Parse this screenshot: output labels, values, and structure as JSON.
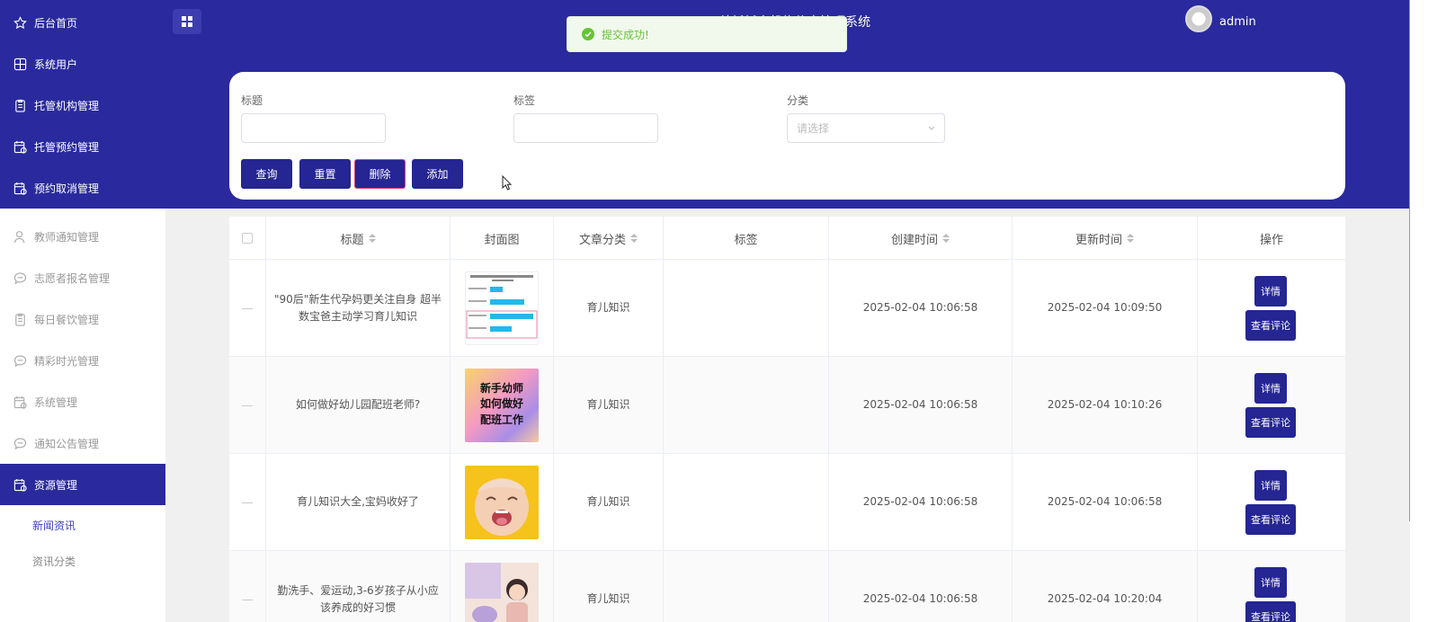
{
  "app": {
    "title": "幼托托育机构信息管理系统",
    "user": "admin"
  },
  "toast": {
    "message": "提交成功!"
  },
  "sidebar": {
    "items": [
      {
        "label": "后台首页",
        "icon": "star-icon"
      },
      {
        "label": "系统用户",
        "icon": "grid-icon"
      },
      {
        "label": "托管机构管理",
        "icon": "clipboard-icon"
      },
      {
        "label": "托管预约管理",
        "icon": "calendar-icon"
      },
      {
        "label": "预约取消管理",
        "icon": "calendar-icon"
      },
      {
        "label": "教师通知管理",
        "icon": "user-icon"
      },
      {
        "label": "志愿者报名管理",
        "icon": "chat-icon"
      },
      {
        "label": "每日餐饮管理",
        "icon": "clipboard-icon"
      },
      {
        "label": "精彩时光管理",
        "icon": "chat-icon"
      },
      {
        "label": "系统管理",
        "icon": "calendar-icon"
      },
      {
        "label": "通知公告管理",
        "icon": "chat-icon"
      },
      {
        "label": "资源管理",
        "icon": "calendar-icon"
      }
    ],
    "sub_items": [
      {
        "label": "新闻资讯"
      },
      {
        "label": "资讯分类"
      }
    ]
  },
  "search": {
    "title_label": "标题",
    "tag_label": "标签",
    "category_label": "分类",
    "category_placeholder": "请选择",
    "buttons": {
      "query": "查询",
      "reset": "重置",
      "delete": "删除",
      "add": "添加"
    }
  },
  "table": {
    "headers": {
      "title": "标题",
      "cover": "封面图",
      "category": "文章分类",
      "tags": "标签",
      "created": "创建时间",
      "updated": "更新时间",
      "actions": "操作"
    },
    "detail_label": "详情",
    "comments_label": "查看评论",
    "rows": [
      {
        "title": "\"90后\"新生代孕妈更关注自身 超半数宝爸主动学习育儿知识",
        "category": "育儿知识",
        "tags": "",
        "created": "2025-02-04 10:06:58",
        "updated": "2025-02-04 10:09:50"
      },
      {
        "title": "如何做好幼儿园配班老师?",
        "category": "育儿知识",
        "tags": "",
        "created": "2025-02-04 10:06:58",
        "updated": "2025-02-04 10:10:26"
      },
      {
        "title": "育儿知识大全,宝妈收好了",
        "category": "育儿知识",
        "tags": "",
        "created": "2025-02-04 10:06:58",
        "updated": "2025-02-04 10:06:58"
      },
      {
        "title": "勤洗手、爱运动,3-6岁孩子从小应该养成的好习惯",
        "category": "育儿知识",
        "tags": "",
        "created": "2025-02-04 10:06:58",
        "updated": "2025-02-04 10:20:04"
      }
    ],
    "cover2_text": {
      "line1": "新手幼师",
      "line2": "如何做好",
      "line3": "配班工作"
    }
  }
}
